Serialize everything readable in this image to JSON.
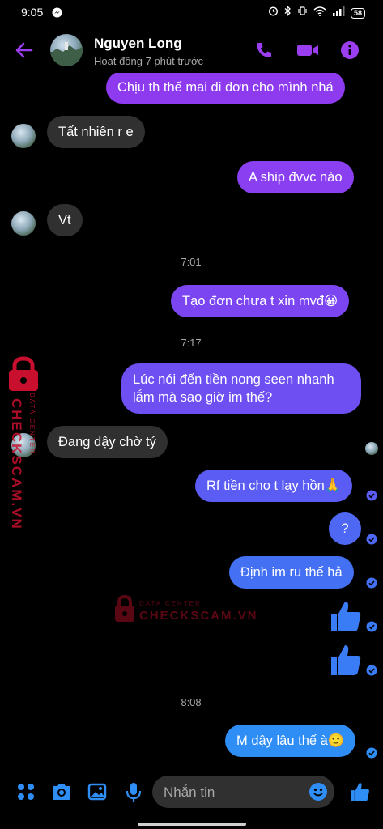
{
  "status_bar": {
    "time": "9:05",
    "battery": "58"
  },
  "header": {
    "contact_name": "Nguyen Long",
    "activity_status": "Hoạt động 7 phút trước"
  },
  "colors": {
    "accent": "#9b3ef0",
    "bubble_in": "#303030",
    "blue": "#2f8ef5",
    "watermark": "#c8102e"
  },
  "messages": [
    {
      "text": "Chịu th thế mai đi đơn cho mình nhá",
      "dir": "out"
    },
    {
      "text": "Tất nhiên r e",
      "dir": "in"
    },
    {
      "text": "A ship đvvc nào",
      "dir": "out"
    },
    {
      "text": "Vt",
      "dir": "in"
    },
    {
      "text": "Tạo đơn chưa t xin mvđ😀",
      "dir": "out"
    },
    {
      "line1": "Lúc nói đến tiền nong seen nhanh",
      "line2": "lắm mà sao giờ im thế?",
      "dir": "out"
    },
    {
      "text": "Đang dậy chờ tý",
      "dir": "in"
    },
    {
      "text": "Rf tiền cho t lạy hồn🙏",
      "dir": "out"
    },
    {
      "text": "?",
      "dir": "out"
    },
    {
      "text": "Định im ru thế hả",
      "dir": "out"
    },
    {
      "text": "M dậy lâu thế à🙂",
      "dir": "out"
    }
  ],
  "timestamps": [
    "7:01",
    "7:17",
    "8:08"
  ],
  "watermark": {
    "brand": "CHECKSCAM.VN",
    "sub": "DATA CENTER"
  },
  "composer": {
    "placeholder": "Nhắn tin"
  }
}
